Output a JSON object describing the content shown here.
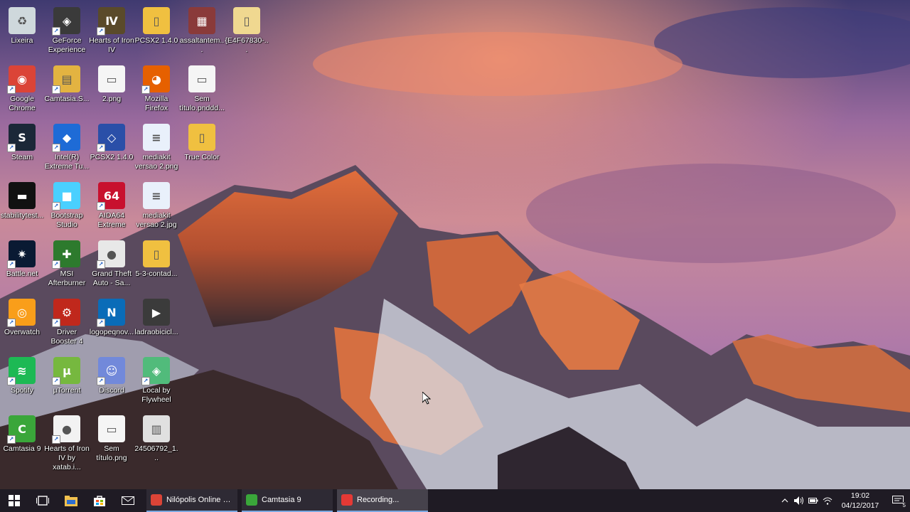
{
  "desktop": {
    "icons": [
      {
        "id": "lixeira",
        "label": "Lixeira",
        "icon": "recycle-bin-icon",
        "color": "#cfd8dc",
        "glyph": "♻"
      },
      {
        "id": "chrome",
        "label": "Google Chrome",
        "icon": "chrome-icon",
        "color": "#db4437",
        "glyph": "◉"
      },
      {
        "id": "steam",
        "label": "Steam",
        "icon": "steam-icon",
        "color": "#1b2838",
        "glyph": "S"
      },
      {
        "id": "stabilitytest",
        "label": "stabilitytest...",
        "icon": "image-file-icon",
        "color": "#111111",
        "glyph": "▬"
      },
      {
        "id": "battlenet",
        "label": "Battle.net",
        "icon": "battlenet-icon",
        "color": "#0a1a33",
        "glyph": "✷"
      },
      {
        "id": "overwatch",
        "label": "Overwatch",
        "icon": "overwatch-icon",
        "color": "#f99e1a",
        "glyph": "◎"
      },
      {
        "id": "spotify",
        "label": "Spotify",
        "icon": "spotify-icon",
        "color": "#1db954",
        "glyph": "≋"
      },
      {
        "id": "camtasia9",
        "label": "Camtasia 9",
        "icon": "camtasia-icon",
        "color": "#3aa63a",
        "glyph": "C"
      },
      {
        "id": "geforce",
        "label": "GeForce Experience",
        "icon": "geforce-icon",
        "color": "#3a3a3a",
        "glyph": "◈"
      },
      {
        "id": "camtasias",
        "label": "Camtasia.S...",
        "icon": "archive-icon",
        "color": "#e3b341",
        "glyph": "▤"
      },
      {
        "id": "intelxtu",
        "label": "Intel(R) Extreme Tu...",
        "icon": "intel-xtu-icon",
        "color": "#1e6bd6",
        "glyph": "◆"
      },
      {
        "id": "bootstrap",
        "label": "Bootstrap Studio",
        "icon": "bootstrap-studio-icon",
        "color": "#4ad0ff",
        "glyph": "■"
      },
      {
        "id": "msiafterburner",
        "label": "MSI Afterburner",
        "icon": "msi-afterburner-icon",
        "color": "#2d7a2d",
        "glyph": "✚"
      },
      {
        "id": "driverbooster",
        "label": "Driver Booster 4",
        "icon": "driver-booster-icon",
        "color": "#c0281c",
        "glyph": "⚙"
      },
      {
        "id": "utorrent",
        "label": "µTorrent",
        "icon": "utorrent-icon",
        "color": "#76b83f",
        "glyph": "µ"
      },
      {
        "id": "hoi4xatab",
        "label": "Hearts of Iron IV by xatab.i...",
        "icon": "document-icon",
        "color": "#f2f2f2",
        "glyph": "●"
      },
      {
        "id": "hoi4",
        "label": "Hearts of Iron IV",
        "icon": "hearts-of-iron-icon",
        "color": "#5a4a2a",
        "glyph": "Ⅳ"
      },
      {
        "id": "twopng",
        "label": "2.png",
        "icon": "image-file-icon",
        "color": "#f5f5f5",
        "glyph": "▭"
      },
      {
        "id": "pcsx2short",
        "label": "PCSX2 1.4.0",
        "icon": "pcsx2-icon",
        "color": "#2a4fa8",
        "glyph": "◇"
      },
      {
        "id": "aida64",
        "label": "AIDA64 Extreme",
        "icon": "aida64-icon",
        "color": "#c8102e",
        "glyph": "64"
      },
      {
        "id": "gta",
        "label": "Grand Theft Auto - Sa...",
        "icon": "document-icon",
        "color": "#e8e8e8",
        "glyph": "●"
      },
      {
        "id": "logopeqno",
        "label": "logopeqnov...",
        "icon": "nilopolis-logo-icon",
        "color": "#0a6cb8",
        "glyph": "N"
      },
      {
        "id": "discord",
        "label": "Discord",
        "icon": "discord-icon",
        "color": "#7289da",
        "glyph": "☺"
      },
      {
        "id": "semtitulo2",
        "label": "Sem título.png",
        "icon": "image-file-icon",
        "color": "#f5f5f5",
        "glyph": "▭"
      },
      {
        "id": "pcsx2folder",
        "label": "PCSX2 1.4.0",
        "icon": "folder-icon",
        "color": "#f0c040",
        "glyph": "▯"
      },
      {
        "id": "firefox",
        "label": "Mozilla Firefox",
        "icon": "firefox-icon",
        "color": "#e66000",
        "glyph": "◕"
      },
      {
        "id": "mediakit1",
        "label": "mediakit versao 2.png",
        "icon": "image-file-icon",
        "color": "#e9f0fb",
        "glyph": "≡"
      },
      {
        "id": "mediakit2",
        "label": "mediakit versao 2.jpg",
        "icon": "image-file-icon",
        "color": "#e9f0fb",
        "glyph": "≡"
      },
      {
        "id": "contad",
        "label": "5-3-contad...",
        "icon": "folder-icon",
        "color": "#f0c040",
        "glyph": "▯"
      },
      {
        "id": "ladrao",
        "label": "ladraobicicl...",
        "icon": "video-file-icon",
        "color": "#3b3b3b",
        "glyph": "▶"
      },
      {
        "id": "localflywheel",
        "label": "Local by Flywheel",
        "icon": "local-flywheel-icon",
        "color": "#51bb7b",
        "glyph": "◈"
      },
      {
        "id": "img24506792",
        "label": "24506792_1...",
        "icon": "image-file-icon",
        "color": "#e0e0e0",
        "glyph": "▥"
      },
      {
        "id": "assaltantem",
        "label": "assaltantem...",
        "icon": "image-file-icon",
        "color": "#8a3a3a",
        "glyph": "▦"
      },
      {
        "id": "semtitulo1",
        "label": "Sem título.pnddd...",
        "icon": "image-file-icon",
        "color": "#f5f5f5",
        "glyph": "▭"
      },
      {
        "id": "truecolor",
        "label": "True Color",
        "icon": "folder-icon",
        "color": "#f0c040",
        "glyph": "▯"
      },
      {
        "id": "e4f67830",
        "label": "{E4F67830-...",
        "icon": "folder-icon",
        "color": "#f0d890",
        "glyph": "▯"
      }
    ]
  },
  "taskbar": {
    "start_icon": "windows-start-icon",
    "task_view_icon": "task-view-icon",
    "explorer_icon": "file-explorer-icon",
    "store_icon": "store-icon",
    "mail_icon": "mail-icon",
    "apps": [
      {
        "label": "Nilópolis Online - I...",
        "icon": "chrome-icon",
        "color": "#db4437",
        "active": false
      },
      {
        "label": "Camtasia 9",
        "icon": "camtasia-icon",
        "color": "#3aa63a",
        "active": false
      },
      {
        "label": "Recording...",
        "icon": "camtasia-recorder-icon",
        "color": "#e53935",
        "active": true
      }
    ],
    "tray": {
      "time": "19:02",
      "date": "04/12/2017",
      "notification_count": "5"
    }
  }
}
